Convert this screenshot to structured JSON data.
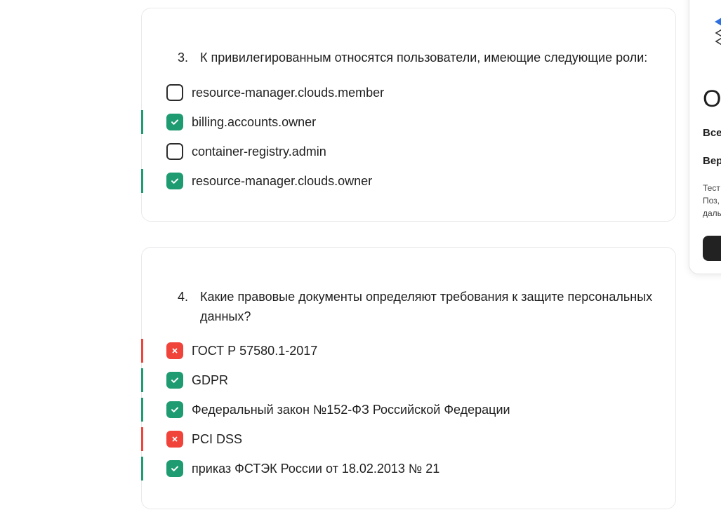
{
  "colors": {
    "correct": "#1e9b71",
    "wrong": "#f0433a",
    "border": "#e9e9ec"
  },
  "questions": [
    {
      "number": "3.",
      "text": "К привилегированным относятся пользователи, имеющие следующие роли:",
      "options": [
        {
          "label": "resource-manager.clouds.member",
          "state": "unchecked"
        },
        {
          "label": "billing.accounts.owner",
          "state": "correct"
        },
        {
          "label": "container-registry.admin",
          "state": "unchecked"
        },
        {
          "label": "resource-manager.clouds.owner",
          "state": "correct"
        }
      ]
    },
    {
      "number": "4.",
      "text": "Какие правовые документы определяют требования к защите персональных данных?",
      "options": [
        {
          "label": "ГОСТ Р 57580.1-2017",
          "state": "wrong"
        },
        {
          "label": "GDPR",
          "state": "correct"
        },
        {
          "label": "Федеральный закон №152-ФЗ Российской Федерации",
          "state": "correct"
        },
        {
          "label": "PCI DSS",
          "state": "wrong"
        },
        {
          "label": "приказ ФСТЭК России от 18.02.2013 № 21",
          "state": "correct"
        }
      ]
    }
  ],
  "side_panel": {
    "title": "Ос",
    "row1": "Все",
    "row2": "Вер",
    "small_lines": [
      "Тест",
      "Поз,",
      "даль"
    ]
  }
}
